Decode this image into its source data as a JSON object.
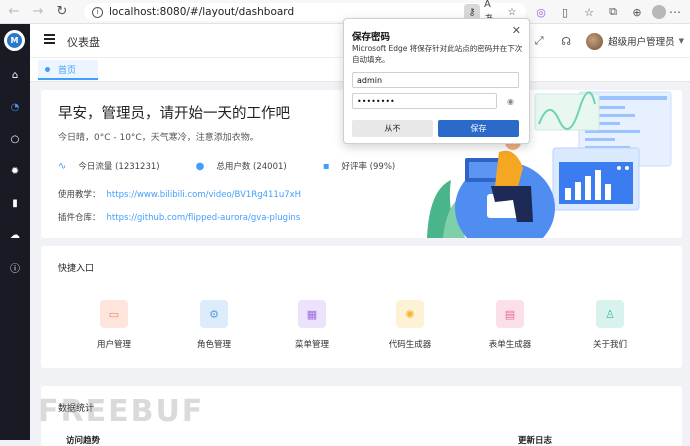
{
  "browser": {
    "back_icon": "arrow-left-icon",
    "forward_icon": "arrow-right-icon",
    "reload_icon": "reload-icon",
    "url": "localhost:8080/#/layout/dashboard"
  },
  "sidebar": {
    "items": [
      "home-icon",
      "dashboard-icon",
      "user-icon",
      "gear-icon",
      "book-icon",
      "cloud-icon",
      "info-icon"
    ]
  },
  "topbar": {
    "breadcrumb": "仪表盘",
    "user_name": "超级用户管理员"
  },
  "tab": {
    "label": "首页"
  },
  "welcome": {
    "greeting": "早安，管理员，请开始一天的工作吧",
    "weather": "今日晴，0°C - 10°C，天气寒冷，注意添加衣物。",
    "stats": [
      {
        "icon": "pulse-icon",
        "text": "今日流量 (1231231)"
      },
      {
        "icon": "users-icon",
        "text": "总用户数 (24001)"
      },
      {
        "icon": "chat-icon",
        "text": "好评率 (99%)"
      }
    ],
    "tutorial_label": "使用教学：",
    "tutorial_url": "https://www.bilibili.com/video/BV1Rg411u7xH",
    "plugins_label": "插件仓库：",
    "plugins_url": "https://github.com/flipped-aurora/gva-plugins"
  },
  "quick": {
    "title": "快捷入口",
    "items": [
      {
        "label": "用户管理",
        "color": "#fde4dc",
        "fg": "#f08a6a"
      },
      {
        "label": "角色管理",
        "color": "#dcecfb",
        "fg": "#5a9be6"
      },
      {
        "label": "菜单管理",
        "color": "#ece2fb",
        "fg": "#9b6ae6"
      },
      {
        "label": "代码生成器",
        "color": "#fdf1d6",
        "fg": "#f0b830"
      },
      {
        "label": "表单生成器",
        "color": "#fbe0ea",
        "fg": "#e86a9a"
      },
      {
        "label": "关于我们",
        "color": "#d8f3ee",
        "fg": "#3dbfa8"
      }
    ]
  },
  "data_stats": {
    "title": "数据统计",
    "left_sub": "访问趋势",
    "right_sub": "更新日志"
  },
  "watermark": "FREEBUF",
  "password_popup": {
    "title": "保存密码",
    "description": "Microsoft Edge 将保存针对此站点的密码并在下次自动填充。",
    "username": "admin",
    "password": "••••••••",
    "never_label": "从不",
    "save_label": "保存"
  }
}
